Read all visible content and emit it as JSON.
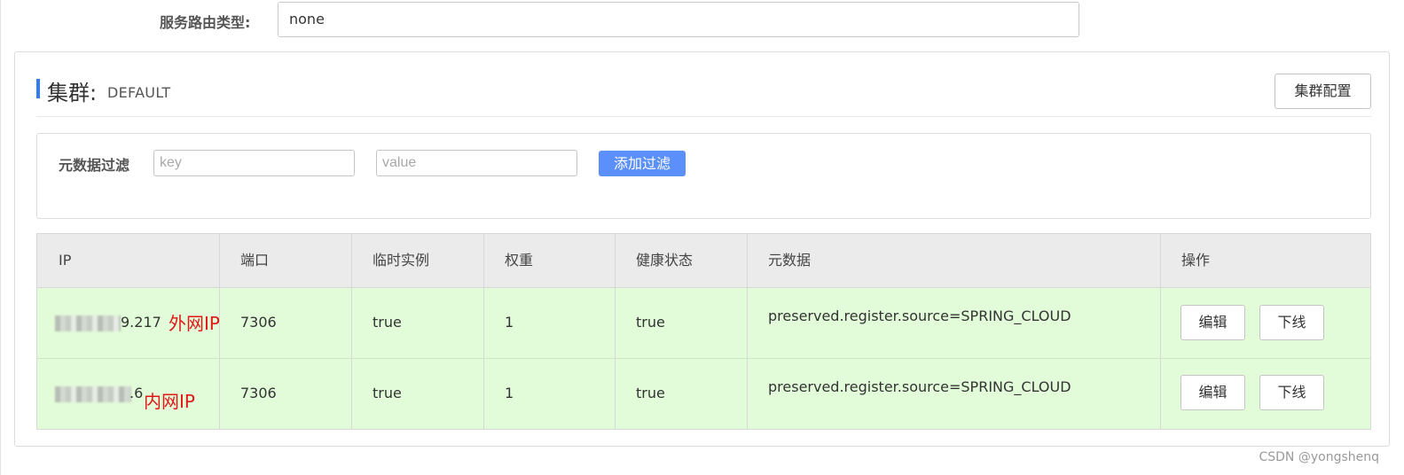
{
  "route": {
    "label": "服务路由类型:",
    "value": "none"
  },
  "cluster": {
    "title": "集群:",
    "name": "DEFAULT",
    "config_button": "集群配置"
  },
  "filter": {
    "label": "元数据过滤",
    "key_placeholder": "key",
    "value_placeholder": "value",
    "add_button": "添加过滤"
  },
  "table": {
    "headers": [
      "IP",
      "端口",
      "临时实例",
      "权重",
      "健康状态",
      "元数据",
      "操作"
    ],
    "rows": [
      {
        "ip_visible": "9.217",
        "ip_tag": "外网IP",
        "port": "7306",
        "ephemeral": "true",
        "weight": "1",
        "healthy": "true",
        "metadata": "preserved.register.source=SPRING_CLOUD",
        "edit": "编辑",
        "offline": "下线"
      },
      {
        "ip_visible": ".6",
        "ip_tag": "内网IP",
        "port": "7306",
        "ephemeral": "true",
        "weight": "1",
        "healthy": "true",
        "metadata": "preserved.register.source=SPRING_CLOUD",
        "edit": "编辑",
        "offline": "下线"
      }
    ]
  },
  "watermark": "CSDN @yongshenq",
  "colors": {
    "accent": "#2f7cf6",
    "primary_button": "#5b8ff9",
    "row_highlight": "#e2fcd9",
    "tag_red": "#e01818"
  }
}
